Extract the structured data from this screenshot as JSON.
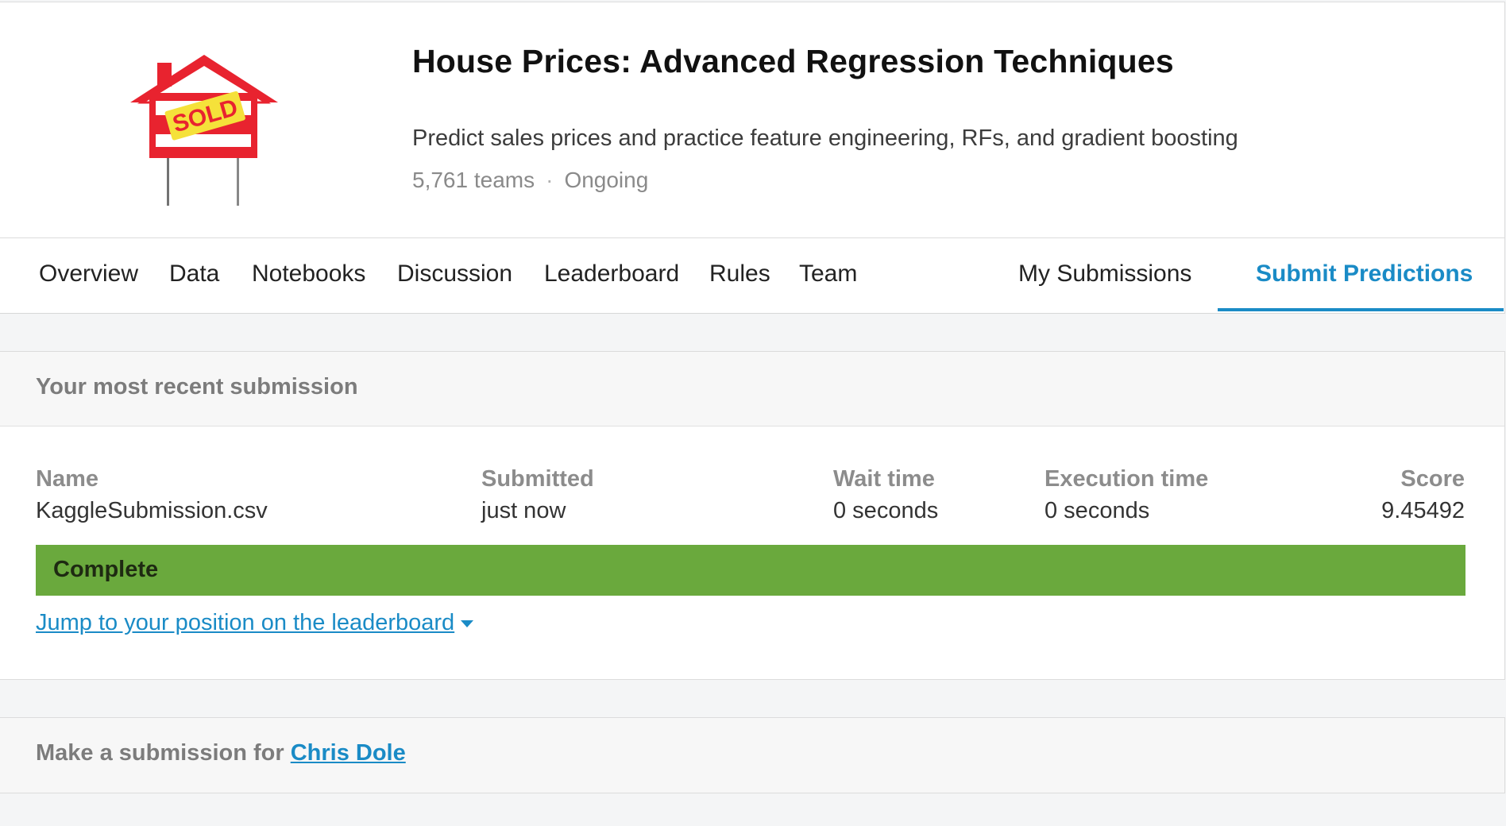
{
  "competition": {
    "title": "House Prices: Advanced Regression Techniques",
    "subtitle": "Predict sales prices and practice feature engineering, RFs, and gradient boosting",
    "teams": "5,761 teams",
    "separator": "·",
    "status": "Ongoing",
    "logo_icon": "sold-house-sign-icon",
    "logo_text": "SOLD"
  },
  "tabs": {
    "overview": "Overview",
    "data": "Data",
    "notebooks": "Notebooks",
    "discussion": "Discussion",
    "leaderboard": "Leaderboard",
    "rules": "Rules",
    "team": "Team",
    "my_submissions": "My Submissions",
    "submit_predictions": "Submit Predictions",
    "active": "Submit Predictions"
  },
  "recent": {
    "title": "Your most recent submission",
    "columns": {
      "name": "Name",
      "submitted": "Submitted",
      "wait": "Wait time",
      "execution": "Execution time",
      "score": "Score"
    },
    "values": {
      "name": "KaggleSubmission.csv",
      "submitted": "just now",
      "wait": "0 seconds",
      "execution": "0 seconds",
      "score": "9.45492"
    },
    "status": "Complete",
    "jump_link": "Jump to your position on the leaderboard"
  },
  "make_submission": {
    "prefix": "Make a submission for ",
    "user": "Chris Dole"
  },
  "colors": {
    "accent": "#1a8bc6",
    "complete": "#6aa93d",
    "sign_red": "#e8232f",
    "sold_yellow": "#f5e13a"
  }
}
